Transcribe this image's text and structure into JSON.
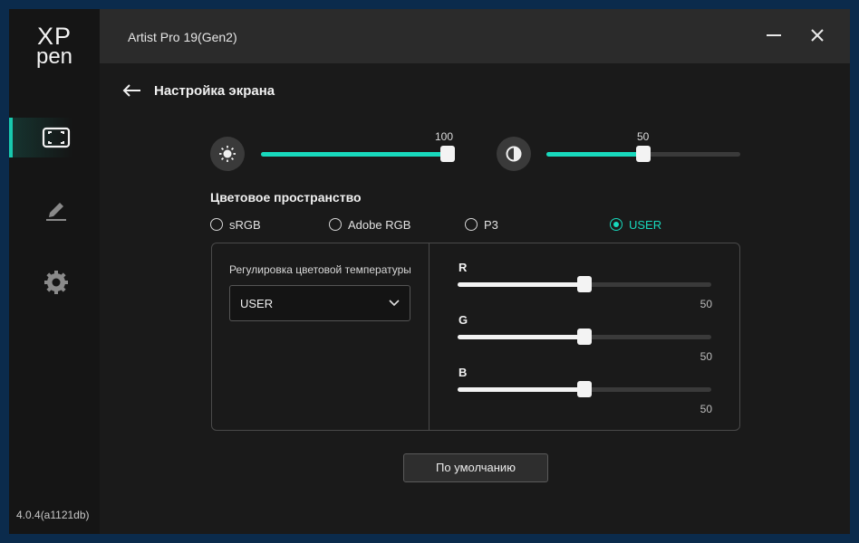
{
  "app": {
    "window_title": "Artist Pro 19(Gen2)",
    "logo_top": "XP",
    "logo_bottom": "pen",
    "version": "4.0.4(a1121db)"
  },
  "sidebar": {
    "items": [
      {
        "name": "display",
        "icon": "display-frame-icon",
        "active": true
      },
      {
        "name": "pen",
        "icon": "pen-icon",
        "active": false
      },
      {
        "name": "settings",
        "icon": "gear-icon",
        "active": false
      }
    ]
  },
  "page": {
    "title": "Настройка экрана",
    "brightness": {
      "icon": "brightness-icon",
      "value": "100",
      "level": 100
    },
    "contrast": {
      "icon": "contrast-icon",
      "value": "50",
      "level": 50
    },
    "color_space_title": "Цветовое пространство",
    "color_spaces": [
      {
        "label": "sRGB",
        "selected": false
      },
      {
        "label": "Adobe RGB",
        "selected": false
      },
      {
        "label": "P3",
        "selected": false
      },
      {
        "label": "USER",
        "selected": true
      }
    ],
    "temp_label": "Регулировка цветовой температуры",
    "temp_select": "USER",
    "rgb": [
      {
        "label": "R",
        "value": "50",
        "level": 50
      },
      {
        "label": "G",
        "value": "50",
        "level": 50
      },
      {
        "label": "B",
        "value": "50",
        "level": 50
      }
    ],
    "default_button": "По умолчанию"
  },
  "colors": {
    "accent": "#18d9bd",
    "background": "#1a1a1a",
    "sidebar": "#151515",
    "outer": "#0b2b4c"
  }
}
